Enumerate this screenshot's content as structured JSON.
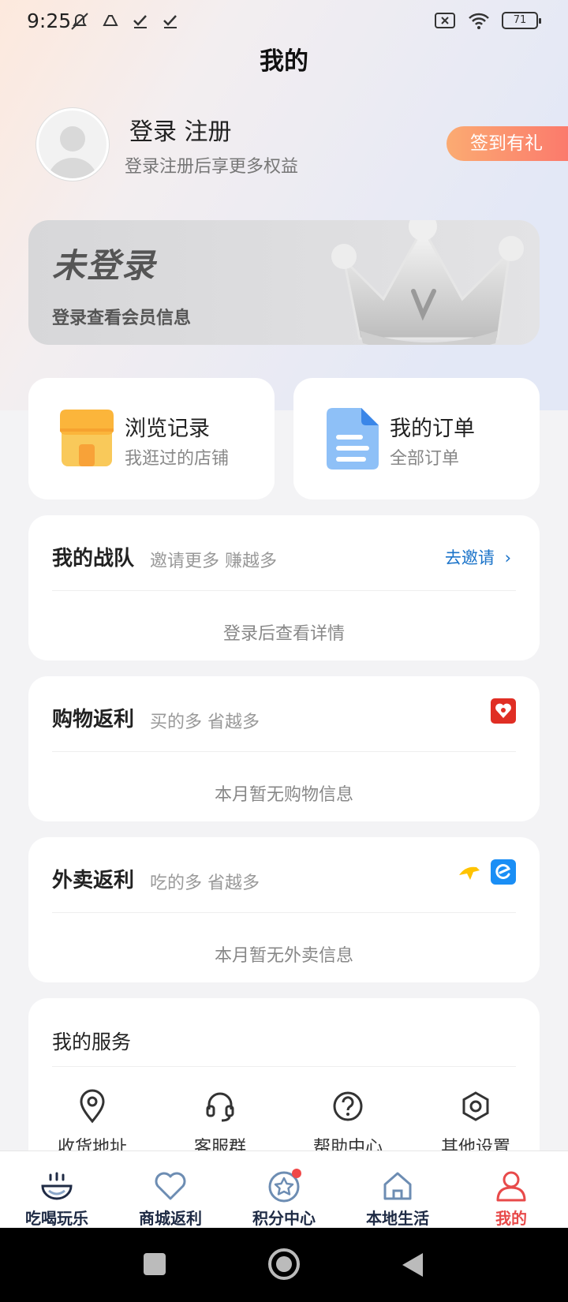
{
  "status_bar": {
    "time": "9:25",
    "battery": "71"
  },
  "header": {
    "title": "我的"
  },
  "profile": {
    "login_text": "登录 注册",
    "subtitle": "登录注册后享更多权益",
    "signin_button": "签到有礼"
  },
  "member_card": {
    "title": "未登录",
    "subtitle": "登录查看会员信息"
  },
  "quick_links": [
    {
      "title": "浏览记录",
      "subtitle": "我逛过的店铺",
      "icon": "store-icon"
    },
    {
      "title": "我的订单",
      "subtitle": "全部订单",
      "icon": "document-icon"
    }
  ],
  "team": {
    "title": "我的战队",
    "subtitle": "邀请更多 赚越多",
    "action": "去邀请",
    "empty": "登录后查看详情"
  },
  "shopping": {
    "title": "购物返利",
    "subtitle": "买的多 省越多",
    "empty": "本月暂无购物信息",
    "icon": "pinduoduo-icon"
  },
  "takeout": {
    "title": "外卖返利",
    "subtitle": "吃的多 省越多",
    "empty": "本月暂无外卖信息",
    "icons": [
      "meituan-icon",
      "eleme-icon"
    ]
  },
  "services": {
    "title": "我的服务",
    "items": [
      {
        "label": "收货地址",
        "icon": "location-icon"
      },
      {
        "label": "客服群",
        "icon": "headset-icon"
      },
      {
        "label": "帮助中心",
        "icon": "help-icon"
      },
      {
        "label": "其他设置",
        "icon": "settings-icon"
      }
    ]
  },
  "tabs": [
    {
      "label": "吃喝玩乐",
      "icon": "food-bowl-icon"
    },
    {
      "label": "商城返利",
      "icon": "heart-icon"
    },
    {
      "label": "积分中心",
      "icon": "star-badge-icon"
    },
    {
      "label": "本地生活",
      "icon": "home-icon"
    },
    {
      "label": "我的",
      "icon": "person-icon",
      "active": true
    }
  ],
  "colors": {
    "accent": "#e84a4a",
    "link": "#1a73c9",
    "tab_text": "#1f2b45"
  }
}
